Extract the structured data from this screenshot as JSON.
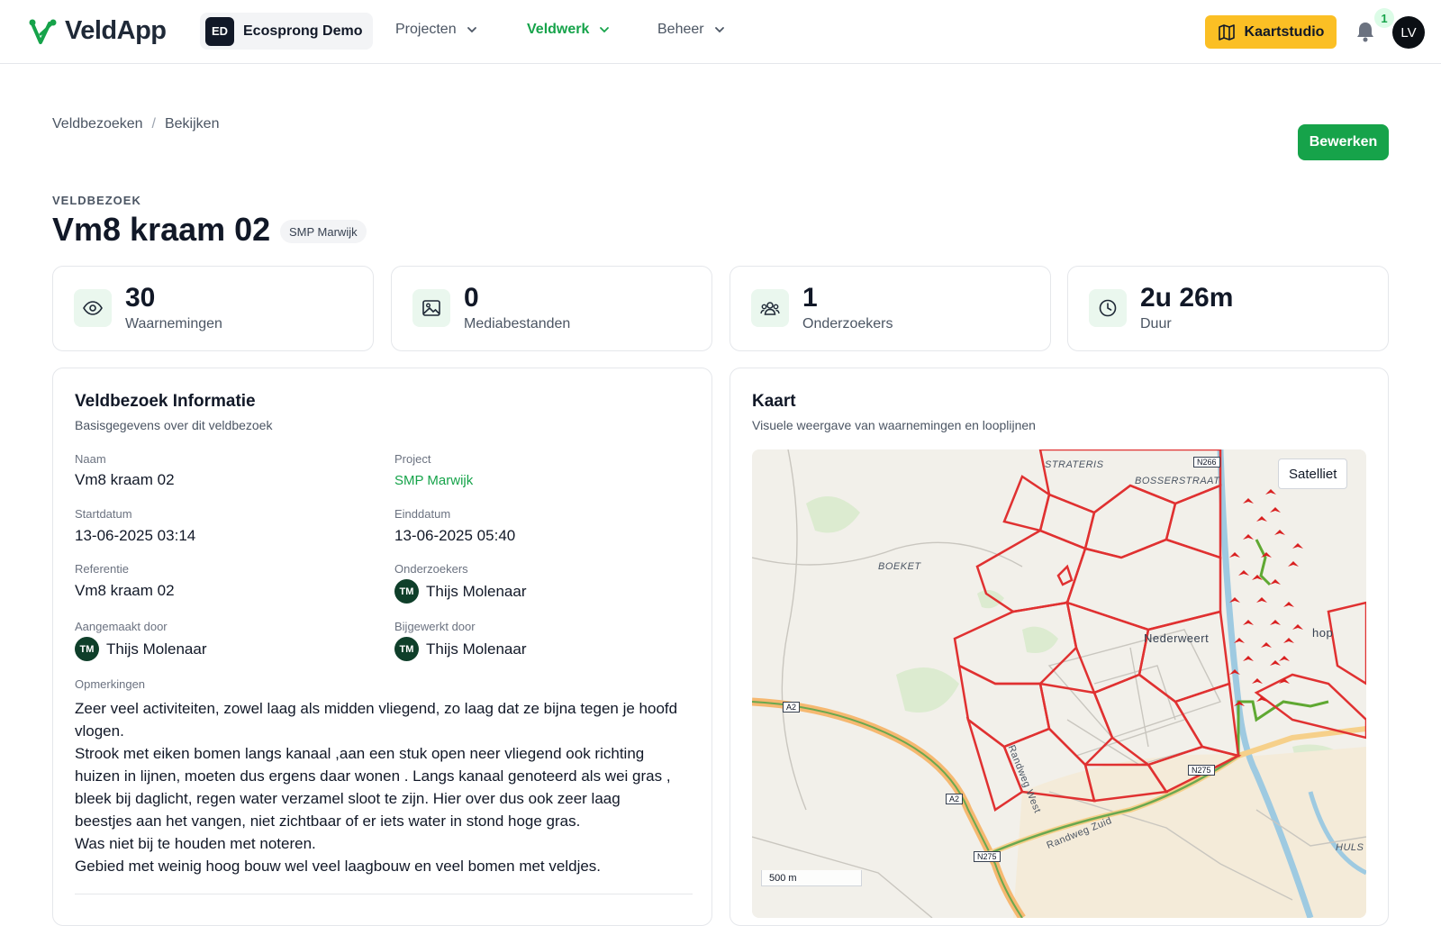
{
  "app": {
    "name": "VeldApp",
    "org_badge": "ED",
    "org_name": "Ecosprong Demo",
    "nav": [
      {
        "label": "Projecten"
      },
      {
        "label": "Veldwerk"
      },
      {
        "label": "Beheer"
      }
    ],
    "map_studio_label": "Kaartstudio",
    "notification_count": "1",
    "user_initials": "LV",
    "accent_color": "#16a34a",
    "warning_color": "#fbbf24"
  },
  "breadcrumb": [
    "Veldbezoeken",
    "Bekijken"
  ],
  "actions": {
    "edit_label": "Bewerken"
  },
  "header": {
    "kicker": "VELDBEZOEK",
    "title": "Vm8 kraam 02",
    "project_tag": "SMP Marwijk"
  },
  "stats": [
    {
      "value": "30",
      "label": "Waarnemingen",
      "icon": "eye-icon"
    },
    {
      "value": "0",
      "label": "Mediabestanden",
      "icon": "image-icon"
    },
    {
      "value": "1",
      "label": "Onderzoekers",
      "icon": "users-icon"
    },
    {
      "value": "2u 26m",
      "label": "Duur",
      "icon": "clock-icon"
    }
  ],
  "info": {
    "title": "Veldbezoek Informatie",
    "subtitle": "Basisgegevens over dit veldbezoek",
    "fields": {
      "name_label": "Naam",
      "name_value": "Vm8 kraam 02",
      "project_label": "Project",
      "project_value": "SMP Marwijk",
      "start_label": "Startdatum",
      "start_value": "13-06-2025 03:14",
      "end_label": "Einddatum",
      "end_value": "13-06-2025 05:40",
      "ref_label": "Referentie",
      "ref_value": "Vm8 kraam 02",
      "researchers_label": "Onderzoekers",
      "researchers_value": "Thijs Molenaar",
      "researchers_initials": "TM",
      "created_label": "Aangemaakt door",
      "created_value": "Thijs Molenaar",
      "created_initials": "TM",
      "updated_label": "Bijgewerkt door",
      "updated_value": "Thijs Molenaar",
      "updated_initials": "TM"
    },
    "notes_label": "Opmerkingen",
    "notes_lines": [
      "Zeer veel activiteiten, zowel laag als midden vliegend, zo laag dat ze bijna tegen je hoofd vlogen.",
      "Strook met eiken bomen langs kanaal ,aan een stuk open neer vliegend ook richting huizen in lijnen, moeten dus ergens daar wonen . Langs kanaal genoteerd als wei gras , bleek bij daglicht, regen water verzamel sloot te zijn. Hier over dus ook zeer laag beestjes aan het vangen, niet zichtbaar of er iets water in stond hoge gras.",
      "Was niet bij te houden met noteren.",
      "Gebied met weinig hoog bouw wel veel laagbouw en veel bomen met veldjes."
    ]
  },
  "map": {
    "title": "Kaart",
    "subtitle": "Visuele weergave van waarnemingen en looplijnen",
    "toggle_label": "Satelliet",
    "scale_label": "500 m",
    "labels": {
      "straat1": "STRATERIS",
      "straat2": "BOSSERSTRAAT",
      "boeket": "BOEKET",
      "wijk": "Nederweert",
      "hop": "hop",
      "huls": "HULS",
      "randweg_west": "Randweg West",
      "randweg_zuid": "Randweg Zuid"
    },
    "shields": {
      "n266": "N266",
      "a2a": "A2",
      "a2b": "A2",
      "n275a": "N275",
      "n275b": "N275"
    }
  }
}
